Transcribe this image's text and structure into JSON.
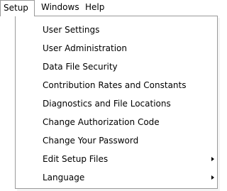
{
  "menubar": {
    "items": [
      {
        "label": "Setup"
      },
      {
        "label": "Windows"
      },
      {
        "label": "Help"
      }
    ]
  },
  "setup_menu": {
    "items": [
      {
        "label": "User Settings"
      },
      {
        "label": "User Administration"
      },
      {
        "label": "Data File Security"
      },
      {
        "label": "Contribution Rates and Constants"
      },
      {
        "label": "Diagnostics and File Locations"
      },
      {
        "label": "Change Authorization Code"
      },
      {
        "label": "Change Your Password"
      },
      {
        "label": "Edit Setup Files",
        "submenu_icon": "triangle-right-icon"
      },
      {
        "label": "Language",
        "submenu_icon": "triangle-right-icon"
      }
    ]
  }
}
